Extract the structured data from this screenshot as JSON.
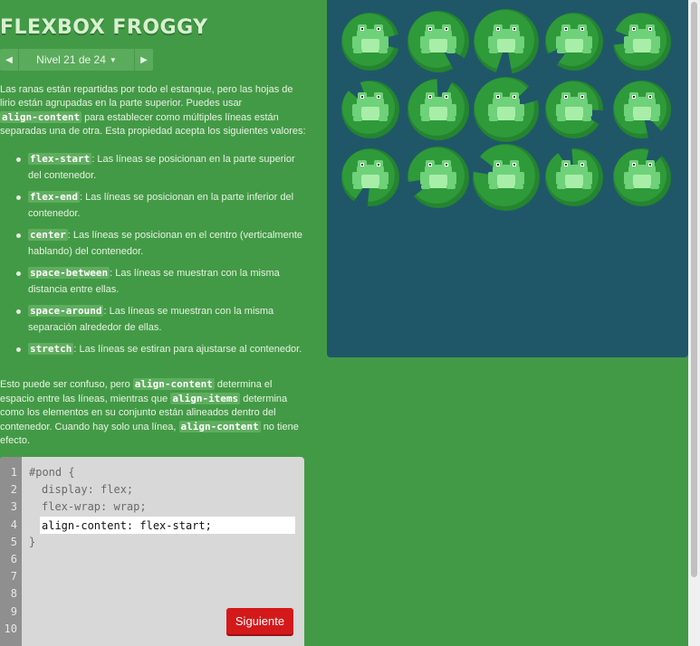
{
  "app": {
    "title": "FLEXBOX FROGGY"
  },
  "level": {
    "prev_arrow": "◀",
    "next_arrow": "▶",
    "label": "Nivel 21 de 24",
    "caret": "▼"
  },
  "instructions": {
    "intro": [
      {
        "t": "Las ranas están repartidas por todo el estanque, pero las hojas de lirio están agrupadas en la parte superior. Puedes usar "
      },
      {
        "c": "align-content"
      },
      {
        "t": " para establecer como múltiples líneas están separadas una de otra. Esta propiedad acepta los siguientes valores:"
      }
    ],
    "values": [
      {
        "code": "flex-start",
        "desc": ": Las líneas se posicionan en la parte superior del contenedor."
      },
      {
        "code": "flex-end",
        "desc": ": Las líneas se posicionan en la parte inferior del contenedor."
      },
      {
        "code": "center",
        "desc": ": Las líneas se posicionan en el centro (verticalmente hablando) del contenedor."
      },
      {
        "code": "space-between",
        "desc": ": Las líneas se muestran con la misma distancia entre ellas."
      },
      {
        "code": "space-around",
        "desc": ": Las líneas se muestran con la misma separación alrededor de ellas."
      },
      {
        "code": "stretch",
        "desc": ": Las líneas se estiran para ajustarse al contenedor."
      }
    ],
    "outro": [
      {
        "t": "Esto puede ser confuso, pero "
      },
      {
        "c": "align-content"
      },
      {
        "t": " determina el espacio entre las líneas, mientras que "
      },
      {
        "c": "align-items"
      },
      {
        "t": " determina como los elementos en su conjunto están alineados dentro del contenedor. Cuando hay solo una línea, "
      },
      {
        "c": "align-content"
      },
      {
        "t": " no tiene efecto."
      }
    ]
  },
  "editor": {
    "line_numbers": [
      "1",
      "2",
      "3",
      "4",
      "5",
      "6",
      "7",
      "8",
      "9",
      "10"
    ],
    "code_lines": [
      "#pond {",
      "display: flex;",
      "flex-wrap: wrap;"
    ],
    "closing_brace": "}",
    "input_value": "align-content: flex-start;",
    "next_button": "Siguiente"
  },
  "pond": {
    "frog_count": 15,
    "colors": {
      "water": "#1f5768",
      "lilypad": "#2f9a3a",
      "lilypad_dark": "#24842f",
      "frog": "#6fd17a",
      "frog_light": "#a8eea8"
    }
  }
}
